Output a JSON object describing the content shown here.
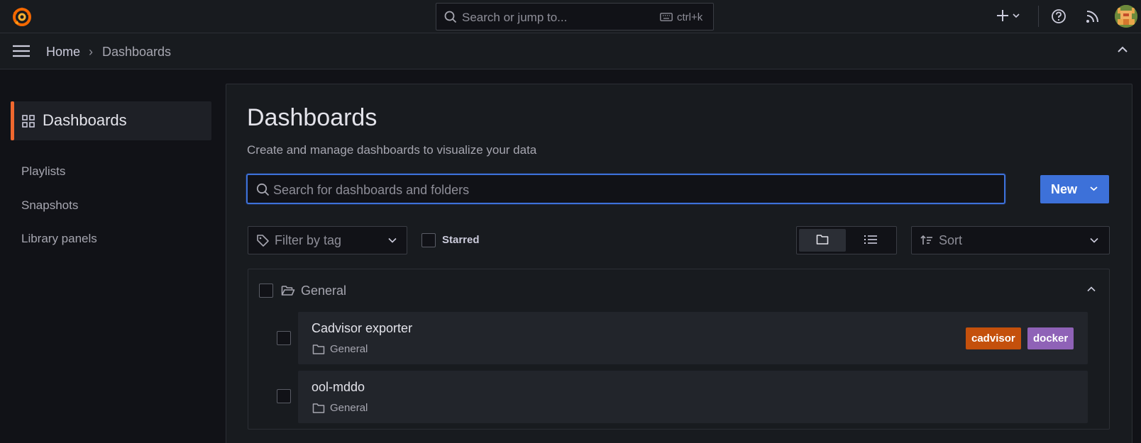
{
  "topbar": {
    "search_placeholder": "Search or jump to...",
    "search_shortcut": "ctrl+k"
  },
  "breadcrumb": {
    "home": "Home",
    "separator": "›",
    "current": "Dashboards"
  },
  "sidenav": {
    "active": "Dashboards",
    "items": [
      {
        "label": "Playlists"
      },
      {
        "label": "Snapshots"
      },
      {
        "label": "Library panels"
      }
    ]
  },
  "main": {
    "title": "Dashboards",
    "subtitle": "Create and manage dashboards to visualize your data",
    "search_placeholder": "Search for dashboards and folders",
    "new_button": "New",
    "tag_filter_placeholder": "Filter by tag",
    "starred_label": "Starred",
    "sort_placeholder": "Sort",
    "folder": {
      "name": "General",
      "dashboards": [
        {
          "title": "Cadvisor exporter",
          "location": "General",
          "tags": [
            {
              "label": "cadvisor",
              "color": "#c4500c"
            },
            {
              "label": "docker",
              "color": "#8f62b7"
            }
          ]
        },
        {
          "title": "ool-mddo",
          "location": "General",
          "tags": []
        }
      ]
    }
  },
  "colors": {
    "accent": "#f0682f",
    "primary": "#3d71d9",
    "background": "#111217",
    "panel": "#181b1f"
  }
}
